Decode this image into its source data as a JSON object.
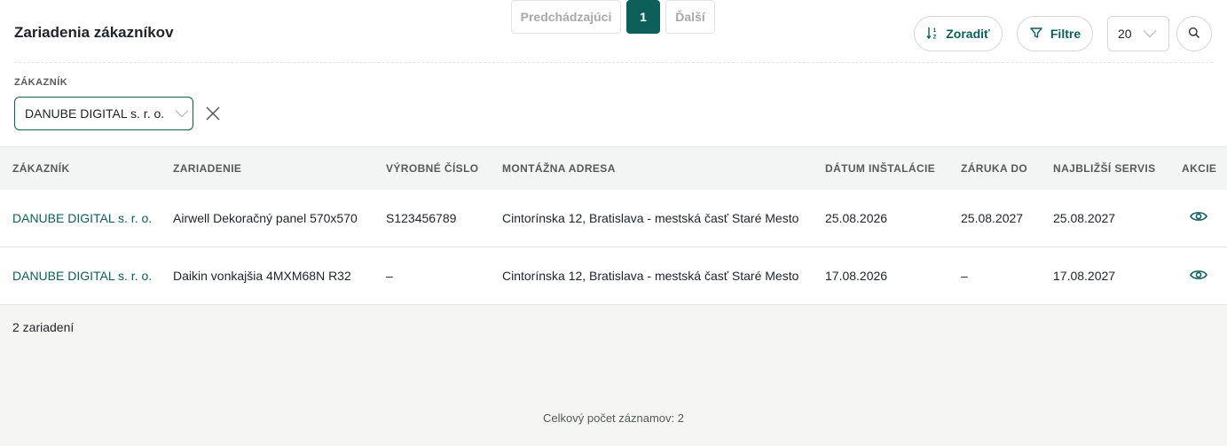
{
  "page": {
    "title": "Zariadenia zákazníkov"
  },
  "toolbar": {
    "sort_label": "Zoradiť",
    "filter_label": "Filtre",
    "page_size": "20"
  },
  "filters": {
    "customer_label": "ZÁKAZNÍK",
    "customer_value": "DANUBE DIGITAL s. r. o."
  },
  "table": {
    "headers": [
      "ZÁKAZNÍK",
      "ZARIADENIE",
      "VÝROBNÉ ČÍSLO",
      "MONTÁŽNA ADRESA",
      "DÁTUM INŠTALÁCIE",
      "ZÁRUKA DO",
      "NAJBLIŽŠÍ SERVIS",
      "AKCIE"
    ],
    "rows": [
      {
        "customer": "DANUBE DIGITAL s. r. o.",
        "device": "Airwell Dekoračný panel 570x570",
        "serial": "S123456789",
        "address": "Cintorínska 12, Bratislava - mestská časť Staré Mesto",
        "installed": "25.08.2026",
        "warranty": "25.08.2027",
        "next_service": "25.08.2027"
      },
      {
        "customer": "DANUBE DIGITAL s. r. o.",
        "device": "Daikin vonkajšia 4MXM68N R32",
        "serial": "–",
        "address": "Cintorínska 12, Bratislava - mestská časť Staré Mesto",
        "installed": "17.08.2026",
        "warranty": "–",
        "next_service": "17.08.2027"
      }
    ],
    "footer_count": "2 zariadení"
  },
  "pagination": {
    "prev_label": "Predchádzajúci",
    "current_page": "1",
    "next_label": "Ďalší",
    "total_label": "Celkový počet záznamov: 2"
  },
  "colors": {
    "accent": "#0d5f5a",
    "border": "#d4d8d6",
    "header_bg": "#f3f5f4"
  },
  "icons": {
    "sort": "sort-az-icon",
    "filter": "funnel-icon",
    "dropdown": "chevron-down-icon",
    "search": "search-icon",
    "clear": "close-icon",
    "view": "eye-icon"
  }
}
